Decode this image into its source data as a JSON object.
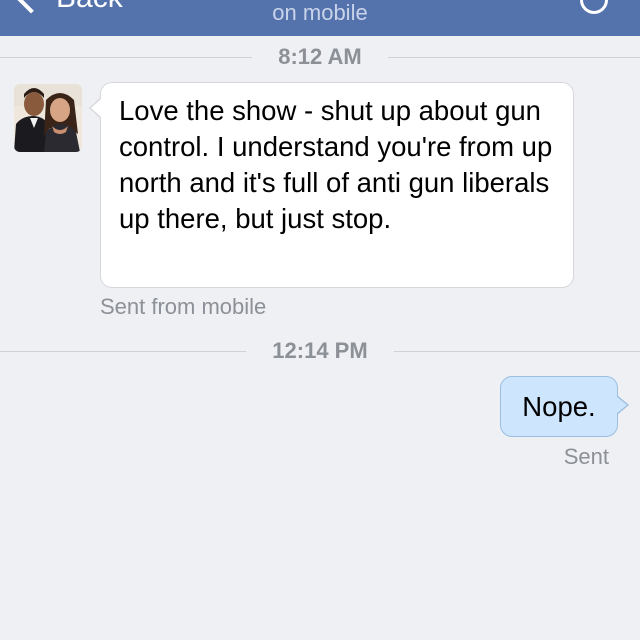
{
  "navbar": {
    "back_label": "Back",
    "subtitle": "on mobile",
    "background_color": "#5472ab",
    "right_icon": "circle-icon"
  },
  "conversation": {
    "separators": [
      {
        "time": "8:12 AM"
      },
      {
        "time": "12:14 PM"
      }
    ],
    "messages": [
      {
        "direction": "incoming",
        "text": "Love the show - shut up about gun control. I understand you're from up north and it's full of anti gun liberals up there, but just stop.",
        "footer": "Sent from mobile",
        "avatar": "sender-avatar-photo"
      },
      {
        "direction": "outgoing",
        "text": "Nope.",
        "footer": "Sent",
        "bubble_color": "#cde6fe"
      }
    ]
  }
}
